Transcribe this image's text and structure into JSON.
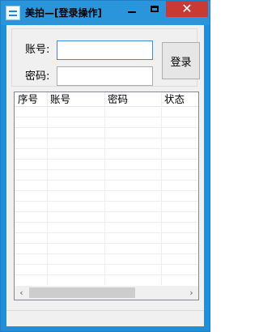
{
  "window": {
    "title": "美拍—[登录操作]",
    "minimize_icon": "minimize-icon",
    "maximize_icon": "maximize-icon",
    "close_glyph": "✕"
  },
  "login": {
    "account_label": "账号:",
    "password_label": "密码:",
    "account_value": "",
    "password_value": "",
    "login_button": "登录"
  },
  "grid": {
    "columns": [
      "序号",
      "账号",
      "密码",
      "状态"
    ],
    "rows": []
  },
  "scrollbar": {
    "left_arrow": "‹",
    "right_arrow": "›"
  },
  "colors": {
    "titlebar": "#2b95dc",
    "close": "#c83a32",
    "client": "#f0f0f0"
  }
}
